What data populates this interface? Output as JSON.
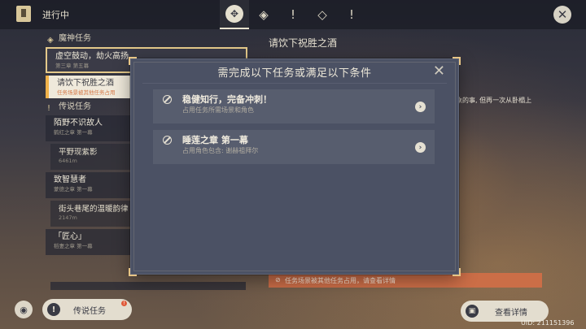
{
  "header": {
    "status": "进行中",
    "tabs": [
      "all-quests-icon",
      "archon-icon",
      "story-icon",
      "world-icon",
      "exclamation-icon"
    ]
  },
  "quest_list": {
    "categories": [
      {
        "label": "魔神任务",
        "icon": "archon-icon"
      },
      {
        "label": "传说任务",
        "icon": "exclamation-icon"
      }
    ],
    "archon_items": [
      {
        "title": "虚空鼓动，劫火高扬",
        "subtitle": "第三章 第五幕"
      },
      {
        "title": "请饮下祝胜之酒",
        "subtitle": "任务场景被其他任务占用"
      }
    ],
    "legend_items": [
      {
        "title": "陌野不识故人",
        "subtitle": "鹤红之章 第一幕",
        "sub": {
          "title": "平野现紫影",
          "subtitle": "6461m"
        }
      },
      {
        "title": "致智慧者",
        "subtitle": "蒙德之章 第一幕",
        "sub": {
          "title": "街头巷尾的温暖韵律",
          "subtitle": "2147m"
        }
      },
      {
        "title": "「匠心」",
        "subtitle": "稻妻之章 第一幕"
      }
    ]
  },
  "detail": {
    "title": "请饮下祝胜之酒",
    "text": "象的事, 但再一次从卧榻上",
    "warning": "任务场景被其他任务占用，请查看详情"
  },
  "modal": {
    "title": "需完成以下任务或满足以下条件",
    "conditions": [
      {
        "title": "稳健知行，完备冲刺！",
        "subtitle": "占用任务所需场景和角色"
      },
      {
        "title": "睡莲之章 第一幕",
        "subtitle": "占用角色包含: 谢赫祖拜尔"
      }
    ]
  },
  "footer": {
    "legend_button": "传说任务",
    "legend_badge": "!",
    "details_button": "查看详情",
    "uid": "UID: 211151396"
  }
}
